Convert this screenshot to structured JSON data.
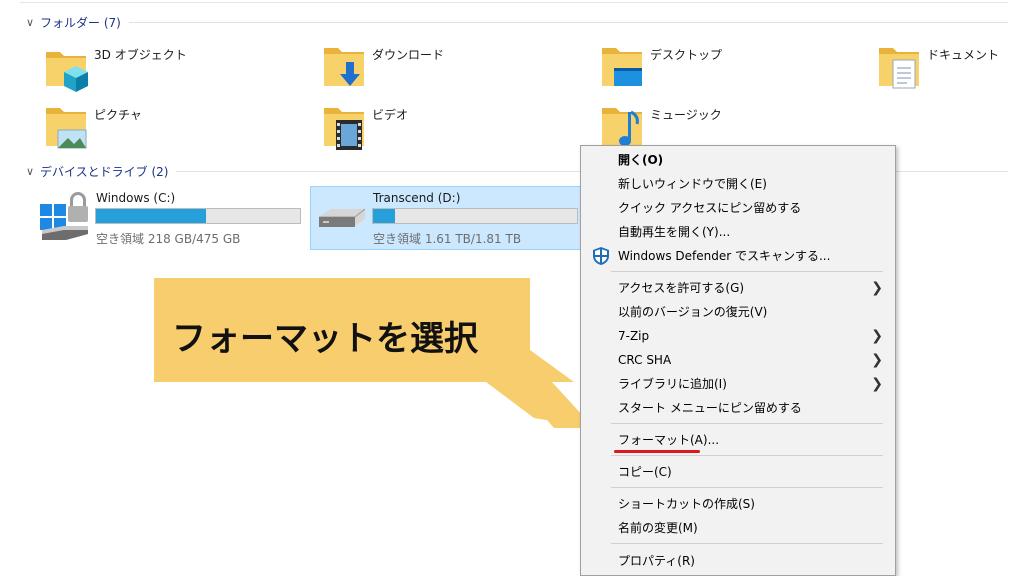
{
  "groups": {
    "folders": {
      "label": "フォルダー (7)"
    },
    "devices": {
      "label": "デバイスとドライブ (2)"
    }
  },
  "folders": [
    {
      "name": "3D オブジェクト",
      "icon": "3d-objects-folder-icon"
    },
    {
      "name": "ダウンロード",
      "icon": "downloads-folder-icon"
    },
    {
      "name": "デスクトップ",
      "icon": "desktop-folder-icon"
    },
    {
      "name": "ドキュメント",
      "icon": "documents-folder-icon"
    },
    {
      "name": "ピクチャ",
      "icon": "pictures-folder-icon"
    },
    {
      "name": "ビデオ",
      "icon": "videos-folder-icon"
    },
    {
      "name": "ミュージック",
      "icon": "music-folder-icon"
    }
  ],
  "drives": [
    {
      "name": "Windows (C:)",
      "free_text": "空き領域 218 GB/475 GB",
      "used_fraction": 0.54,
      "icon": "windows-drive-icon",
      "selected": false
    },
    {
      "name": "Transcend (D:)",
      "free_text": "空き領域 1.61 TB/1.81 TB",
      "used_fraction": 0.11,
      "icon": "removable-drive-icon",
      "selected": true
    }
  ],
  "context_menu": {
    "items": [
      {
        "id": "open",
        "label": "開く(O)",
        "bold": true
      },
      {
        "id": "open-new-window",
        "label": "新しいウィンドウで開く(E)"
      },
      {
        "id": "pin-quick-access",
        "label": "クイック アクセスにピン留めする"
      },
      {
        "id": "autoplay",
        "label": "自動再生を開く(Y)..."
      },
      {
        "id": "defender-scan",
        "label": "Windows Defender でスキャンする...",
        "icon": "windows-defender-shield-icon"
      },
      {
        "id": "give-access",
        "label": "アクセスを許可する(G)",
        "submenu": true
      },
      {
        "id": "restore-versions",
        "label": "以前のバージョンの復元(V)"
      },
      {
        "id": "7zip",
        "label": "7-Zip",
        "submenu": true
      },
      {
        "id": "crc-sha",
        "label": "CRC SHA",
        "submenu": true
      },
      {
        "id": "add-library",
        "label": "ライブラリに追加(I)",
        "submenu": true
      },
      {
        "id": "pin-start",
        "label": "スタート メニューにピン留めする"
      },
      {
        "id": "format",
        "label": "フォーマット(A)..."
      },
      {
        "id": "copy",
        "label": "コピー(C)"
      },
      {
        "id": "create-shortcut",
        "label": "ショートカットの作成(S)"
      },
      {
        "id": "rename",
        "label": "名前の変更(M)"
      },
      {
        "id": "properties",
        "label": "プロパティ(R)"
      }
    ]
  },
  "callout": {
    "text": "フォーマットを選択"
  },
  "colors": {
    "accent": "#26a0da",
    "selection": "#cce8ff",
    "callout": "#f7cd6e",
    "highlight_underline": "#d9191f",
    "folder": "#f5c242"
  }
}
